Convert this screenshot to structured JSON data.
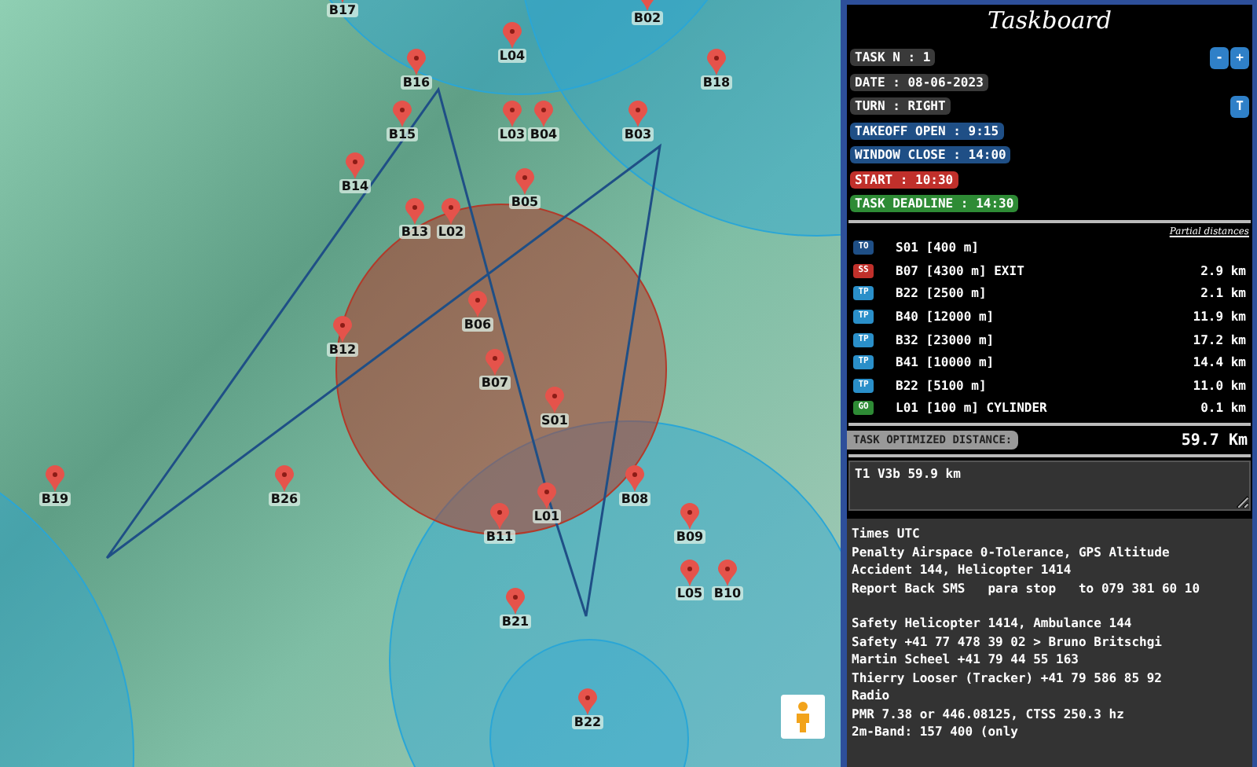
{
  "map": {
    "waypoints": [
      {
        "label": "B17"
      },
      {
        "label": "B02"
      },
      {
        "label": "L04"
      },
      {
        "label": "B16"
      },
      {
        "label": "B18"
      },
      {
        "label": "B15"
      },
      {
        "label": "L03"
      },
      {
        "label": "B04"
      },
      {
        "label": "B03"
      },
      {
        "label": "B14"
      },
      {
        "label": "B05"
      },
      {
        "label": "B13"
      },
      {
        "label": "L02"
      },
      {
        "label": "B06"
      },
      {
        "label": "B12"
      },
      {
        "label": "B07"
      },
      {
        "label": "S01"
      },
      {
        "label": "B19"
      },
      {
        "label": "B26"
      },
      {
        "label": "B08"
      },
      {
        "label": "L01"
      },
      {
        "label": "B11"
      },
      {
        "label": "B09"
      },
      {
        "label": "L05"
      },
      {
        "label": "B10"
      },
      {
        "label": "B21"
      },
      {
        "label": "B22"
      }
    ]
  },
  "taskboard": {
    "title": "Taskboard",
    "info": [
      {
        "text": "TASK N : 1",
        "color": "#3a3a3a"
      },
      {
        "text": "DATE : 08-06-2023",
        "color": "#3a3a3a"
      },
      {
        "text": "TURN : RIGHT",
        "color": "#3a3a3a"
      },
      {
        "text": "TAKEOFF OPEN : 9:15",
        "color": "#1f4f86"
      },
      {
        "text": "WINDOW CLOSE : 14:00",
        "color": "#1f4f86"
      },
      {
        "text": "START : 10:30",
        "color": "#c0302b"
      },
      {
        "text": "TASK DEADLINE : 14:30",
        "color": "#2e8b35"
      }
    ],
    "task_buttons": [
      "-",
      "+"
    ],
    "turn_button": "T",
    "partial_label": "Partial distances",
    "turnpoints": [
      {
        "type": "TO",
        "color": "#1f4f86",
        "name": "S01 [400 m]"
      },
      {
        "type": "SS",
        "color": "#c0302b",
        "name": "B07 [4300 m] EXIT",
        "distance": "2.9 km"
      },
      {
        "type": "TP",
        "color": "#2a8fc9",
        "name": "B22 [2500 m]",
        "distance": "2.1 km"
      },
      {
        "type": "TP",
        "color": "#2a8fc9",
        "name": "B40 [12000 m]",
        "distance": "11.9 km"
      },
      {
        "type": "TP",
        "color": "#2a8fc9",
        "name": "B32 [23000 m]",
        "distance": "17.2 km"
      },
      {
        "type": "TP",
        "color": "#2a8fc9",
        "name": "B41 [10000 m]",
        "distance": "14.4 km"
      },
      {
        "type": "TP",
        "color": "#2a8fc9",
        "name": "B22 [5100 m]",
        "distance": "11.0 km"
      },
      {
        "type": "GO",
        "color": "#2e8b35",
        "name": "L01 [100 m] CYLINDER",
        "distance": "0.1 km"
      }
    ],
    "total_label": "TASK OPTIMIZED DISTANCE:",
    "total": "59.7 Km",
    "comment": "T1 V3b 59.9 km",
    "notes": [
      [
        "Times UTC",
        "Penalty Airspace 0-Tolerance, GPS Altitude",
        "Accident 144, Helicopter 1414",
        "Report Back SMS   para stop   to 079 381 60 10"
      ],
      [
        "Safety Helicopter 1414, Ambulance 144",
        "Safety +41 77 478 39 02 > Bruno Britschgi",
        "Martin Scheel +41 79 44 55 163",
        "Thierry Looser (Tracker) +41 79 586 85 92",
        "Radio",
        "PMR 7.38 or 446.08125, CTSS 250.3 hz",
        "2m-Band: 157 400 (only"
      ]
    ]
  }
}
